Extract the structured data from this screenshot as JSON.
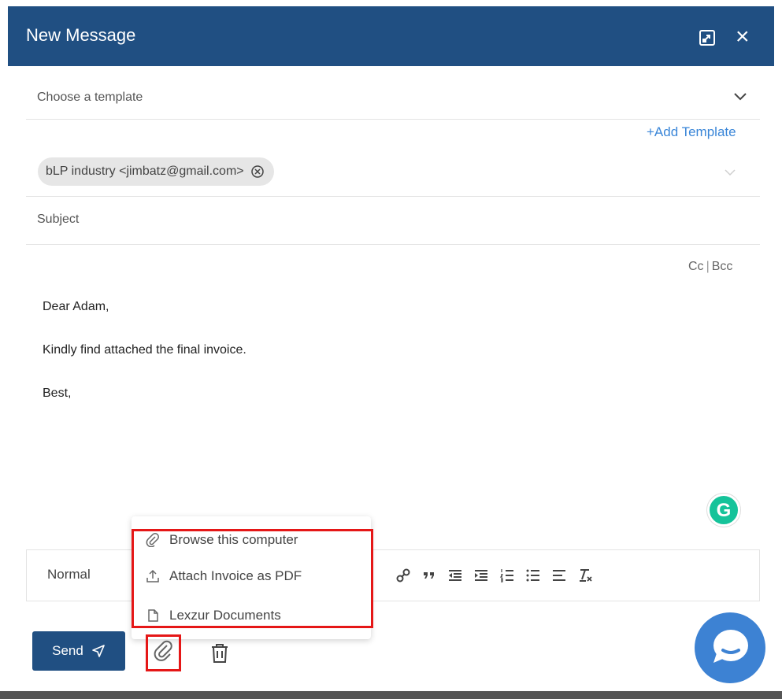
{
  "window": {
    "title": "New Message",
    "header_bg": "#204f82"
  },
  "template": {
    "placeholder": "Choose a template",
    "add_label": "+Add Template"
  },
  "recipients": {
    "chip_text": "bLP industry <jimbatz@gmail.com>"
  },
  "subject": {
    "placeholder": "Subject"
  },
  "cc_label": "Cc",
  "bcc_label": "Bcc",
  "body": {
    "lines": [
      "Dear Adam,",
      "Kindly find attached the final invoice.",
      "Best,"
    ]
  },
  "toolbar": {
    "format_label": "Normal",
    "tools": [
      "link-icon",
      "quote-icon",
      "outdent-icon",
      "indent-icon",
      "ordered-list-icon",
      "bullet-list-icon",
      "align-icon",
      "clear-format-icon"
    ]
  },
  "attach_menu": {
    "items": [
      {
        "label": "Browse this computer",
        "icon": "paperclip-icon"
      },
      {
        "label": "Attach Invoice as PDF",
        "icon": "upload-icon"
      },
      {
        "label": "Lexzur Documents",
        "icon": "document-icon"
      }
    ]
  },
  "actions": {
    "send_label": "Send"
  },
  "colors": {
    "primary": "#204f82",
    "link": "#3a86d8",
    "highlight": "#e51717",
    "grammarly": "#15c39a",
    "chat": "#3d82d3"
  }
}
